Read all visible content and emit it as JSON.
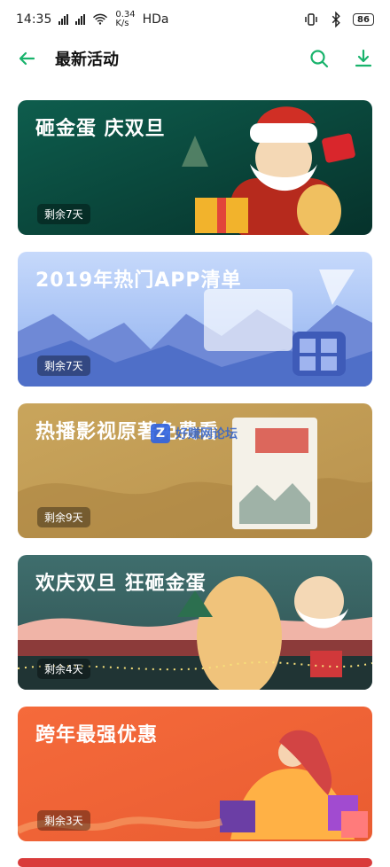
{
  "status_bar": {
    "time": "14:35",
    "network_speed_value": "0.34",
    "network_speed_unit": "K/s",
    "network_type": "HDa",
    "battery": "86"
  },
  "header": {
    "title": "最新活动"
  },
  "cards": [
    {
      "title": "砸金蛋 庆双旦",
      "badge": "剩余7天",
      "bg": "#0f4f41"
    },
    {
      "title": "2019年热门APP清单",
      "badge": "剩余7天",
      "bg": "#9bb9f0"
    },
    {
      "title": "热播影视原著免费看",
      "badge": "剩余9天",
      "bg": "#c6a45d"
    },
    {
      "title": "欢庆双旦 狂砸金蛋",
      "badge": "剩余4天",
      "bg": "#3c6a69"
    },
    {
      "title": "跨年最强优惠",
      "badge": "剩余3天",
      "bg": "#f36c43"
    }
  ],
  "watermark": {
    "text": "好赚网论坛",
    "icon": "Z"
  }
}
